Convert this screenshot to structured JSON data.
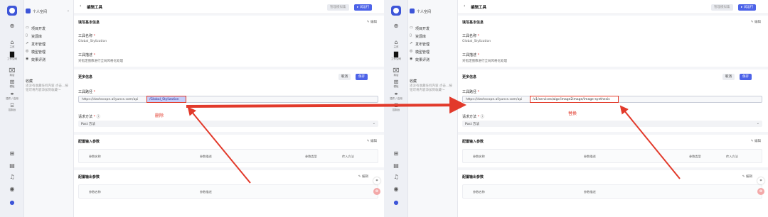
{
  "left": {
    "sidebar_rail": [
      {
        "icon": "plus",
        "label": ""
      },
      {
        "icon": "home",
        "label": "主页"
      },
      {
        "icon": "folder",
        "label": "工作空间"
      },
      {
        "icon": "store",
        "label": "商店"
      },
      {
        "icon": "template",
        "label": "模板"
      },
      {
        "icon": "plugin",
        "label": "插件 / 应用"
      },
      {
        "icon": "console",
        "label": "控制台"
      }
    ],
    "space_name": "个人空间",
    "nav_items": [
      {
        "icon": "▭",
        "label": "项目开发"
      },
      {
        "icon": "▯",
        "label": "资源库"
      },
      {
        "icon": "⇗",
        "label": "发布管理"
      },
      {
        "icon": "◎",
        "label": "模型管理"
      },
      {
        "icon": "◉",
        "label": "效果评测"
      }
    ],
    "favorites_title": "收藏",
    "favorites_hint": "还没有收藏任何内容 点击…按钮可将内容添加到收藏～",
    "page_title": "编辑工具",
    "btn_manage": "管理模拟集",
    "btn_run": "▸ 试运行",
    "basic_section": "填写基本信息",
    "edit_label": "编辑",
    "tool_name_label": "工具名称",
    "tool_name_value": "Global_Stylization",
    "tool_desc_label": "工具描述",
    "tool_desc_value": "对指定图像进行全局风格化处理",
    "more_section": "更多信息",
    "btn_cancel": "取消",
    "btn_save": "保存",
    "path_label": "工具路径",
    "path_base": "https://dashscope.aliyuncs.com/api",
    "path_selected": "/Global_Stylization",
    "method_label": "请求方法",
    "method_value": "Post 方法",
    "input_section": "配置输入参数",
    "input_cols": [
      "参数名称",
      "参数描述",
      "参数类型",
      "传入方法"
    ],
    "output_section": "配置输出参数",
    "output_cols": [
      "参数名称",
      "参数描述"
    ],
    "annotation": "删除"
  },
  "right": {
    "space_name": "个人空间",
    "nav_items": [
      {
        "icon": "▭",
        "label": "项目开发"
      },
      {
        "icon": "▯",
        "label": "资源库"
      },
      {
        "icon": "⇗",
        "label": "发布管理"
      },
      {
        "icon": "◎",
        "label": "模型管理"
      },
      {
        "icon": "◉",
        "label": "效果评测"
      }
    ],
    "favorites_title": "收藏",
    "favorites_hint": "还没有收藏任何内容 点击…按钮可将内容添加到收藏～",
    "page_title": "编辑工具",
    "btn_manage": "管理模拟集",
    "btn_run": "▸ 试运行",
    "basic_section": "填写基本信息",
    "edit_label": "编辑",
    "tool_name_label": "工具名称",
    "tool_name_value": "Global_Stylization",
    "tool_desc_label": "工具描述",
    "tool_desc_value": "对指定图像进行全局风格化处理",
    "more_section": "更多信息",
    "btn_cancel": "取消",
    "btn_save": "保存",
    "path_label": "工具路径",
    "path_base": "https://dashscope.aliyuncs.com/api",
    "path_replaced": "/v1/services/aigc/image2image/image-synthesis",
    "method_label": "请求方法",
    "method_value": "Post 方法",
    "input_section": "配置输入参数",
    "input_cols": [
      "参数名称",
      "参数描述",
      "参数类型",
      "传入方法"
    ],
    "output_section": "配置输出参数",
    "output_cols": [
      "参数名称",
      "参数描述"
    ],
    "annotation": "替换"
  },
  "colors": {
    "accent": "#4d63e8",
    "annotation_red": "#e23a2b"
  }
}
